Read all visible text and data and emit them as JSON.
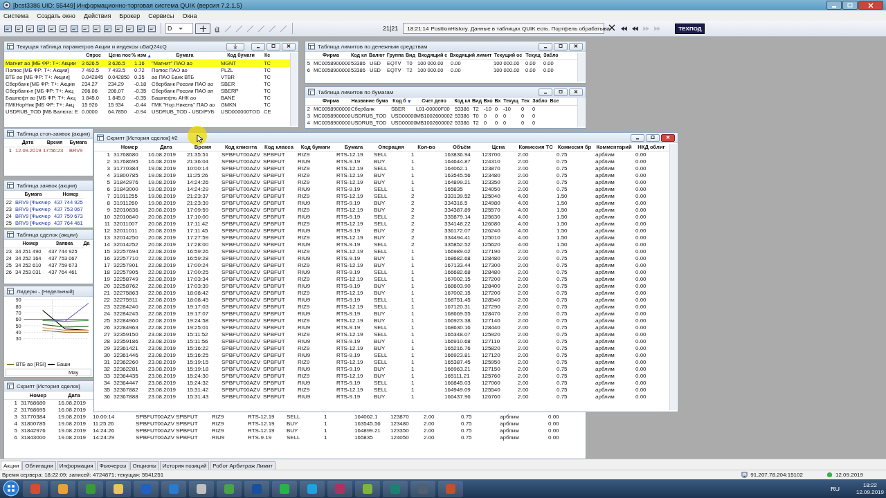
{
  "window": {
    "title": "[bcst3386 UID: 55449] Информационно-торговая система QUIK (версия 7.2.1.5)"
  },
  "menu": [
    "Система",
    "Создать окно",
    "Действия",
    "Брокер",
    "Сервисы",
    "Окна"
  ],
  "toolbar": {
    "interval": "D",
    "counter": "21|21",
    "message_time": "18:21:14",
    "message": "PositionHistory. Данные в таблицах QUIK есть. Портфель обрабатыва",
    "support_label": "ТЕХПОД"
  },
  "windows": [
    {
      "kind": "params",
      "title": "Текущая таблица параметров Акции и индексы u5aQ24cQ",
      "columns": [
        "",
        "Спрос",
        "Цена пос",
        {
          "label": "% изм",
          "sort_icon": "▲"
        },
        "Бумага",
        "Код бумаги",
        "Кс"
      ],
      "rows": [
        {
          "highlighted": true,
          "cells": [
            "Магнит ао [МБ ФР: Т+: Акции",
            "3 626.5",
            "3 626.5",
            "1.16",
            "\"Магнит\" ПАО ао",
            "MGNT",
            "TC"
          ]
        },
        {
          "highlighted": false,
          "cells": [
            "Полюс [МБ ФР: Т+: Акции]",
            "7 492.5",
            "7 493.5",
            "0.72",
            "Полюс ПАО ао",
            "PLZL",
            "TC"
          ]
        },
        {
          "highlighted": false,
          "cells": [
            "ВТБ ао [МБ ФР: Т+: Акции]",
            "0.042845",
            "0.042850",
            "0.35",
            "ао ПАО Банк ВТБ",
            "VTBR",
            "TC"
          ]
        },
        {
          "highlighted": false,
          "cells": [
            "Сбербанк [МБ ФР: Т+: Акции",
            "234.27",
            "234.29",
            "-0.18",
            "Сбербанк России ПАО ао",
            "SBER",
            "TC"
          ]
        },
        {
          "highlighted": false,
          "cells": [
            "Сбербанк-п [МБ ФР: Т+: Акц",
            "206.06",
            "206.07",
            "-0.35",
            "Сбербанк России ПАО ап",
            "SBERP",
            "TC"
          ]
        },
        {
          "highlighted": false,
          "cells": [
            "Башнефт ао [МБ ФР: Т+: Акц",
            "1 845.0",
            "1 845.0",
            "-0.35",
            "Башнефть АНК ао",
            "BANE",
            "TC"
          ]
        },
        {
          "highlighted": false,
          "cells": [
            "ГМКНорНик [МБ ФР: Т+: Акц",
            "15 926",
            "15 934",
            "-0.44",
            "ГМК \"Нор.Никель\" ПАО ао",
            "GMKN",
            "TC"
          ]
        },
        {
          "highlighted": false,
          "cells": [
            "USDRUB_TOD [МБ Валюта: Е",
            "0.0000",
            "64.7850",
            "-0.94",
            "USDRUB_TOD - USD/РУБ",
            "USD000000TOD",
            "CE"
          ]
        }
      ]
    },
    {
      "kind": "money_limits",
      "title": "Таблица лимитов по денежным средствам",
      "columns": [
        "",
        "Фирма",
        "Код кл",
        "Валют",
        "Группа",
        "Вид",
        "Входящий с",
        "Входящий лимит",
        "Текущий ос",
        "Текущ",
        "Забло"
      ],
      "rows": [
        [
          "5",
          "MC0058900000",
          "53386",
          "USD",
          "EQTV",
          "T0",
          "100 000.00",
          "0.00",
          "100 000.00",
          "0.00",
          "0.00"
        ],
        [
          "6",
          "MC0058900000",
          "53386",
          "USD",
          "EQTV",
          "T2",
          "100 000.00",
          "0.00",
          "100 000.00",
          "0.00",
          "0.00"
        ]
      ]
    },
    {
      "kind": "sec_limits",
      "title": "Таблица лимитов по бумагам",
      "columns": [
        "",
        "Фирма",
        "Название бума",
        {
          "label": "Код б",
          "sort_icon": "▼"
        },
        "Счет депо",
        "Код кл",
        "Вид",
        "Вхо",
        "Вх",
        "Текущ",
        "Тек",
        "Забло",
        "Все"
      ],
      "rows": [
        [
          "2",
          "MC0058900000",
          "Сбербанк",
          "SBER",
          "L01-00000F00",
          "53386",
          "T2",
          "-10",
          "0",
          "-10",
          "0",
          "0",
          ""
        ],
        [
          "3",
          "MC0058900000",
          "USDRUB_TOD",
          "USD00000",
          "MB1002600002",
          "53386",
          "T0",
          "0",
          "0",
          "0",
          "0",
          "0",
          ""
        ],
        [
          "4",
          "MC0058900000",
          "USDRUB_TOD",
          "USD00000",
          "MB1002600002",
          "53386",
          "T2",
          "0",
          "0",
          "0",
          "0",
          "0",
          ""
        ]
      ]
    },
    {
      "kind": "stops",
      "title": "Таблица стоп-заявок (акции)",
      "columns": [
        "",
        "Дата",
        "Время",
        "Бумага"
      ],
      "rows": [
        [
          "1",
          "12.09.2019",
          "17:56:23",
          "BRV9"
        ]
      ]
    },
    {
      "kind": "orders",
      "title": "Таблица заявок (акции)",
      "columns": [
        "",
        "Бумага",
        "Номер"
      ],
      "rows": [
        [
          "22",
          "BRV9 [Фьючер",
          "437 744 925"
        ],
        [
          "23",
          "BRV9 [Фьючер",
          "437 753 067"
        ],
        [
          "24",
          "BRV9 [Фьючер",
          "437 759 673"
        ],
        [
          "25",
          "BRV9 [Фьючер",
          "437 764 461"
        ]
      ]
    },
    {
      "kind": "trades",
      "title": "Таблица сделок (акции)",
      "columns": [
        "",
        "Номер",
        "Заявка",
        "Да"
      ],
      "rows": [
        [
          "23",
          "34 251 490",
          "437 744 925"
        ],
        [
          "24",
          "34 252 164",
          "437 753 067"
        ],
        [
          "25",
          "34 252 610",
          "437 759 673"
        ],
        [
          "26",
          "34 253 031",
          "437 764 461"
        ]
      ]
    },
    {
      "kind": "chart",
      "title": "Лидеры - [Недельный]",
      "y_labels": [
        "90",
        "80",
        "70",
        "60",
        "50",
        "40",
        "30"
      ],
      "x_label": "May",
      "legend": [
        {
          "label": "ВТБ ао [RSI]",
          "color": "#8a7a3a"
        },
        {
          "label": "Башн",
          "color": "#000000"
        }
      ]
    },
    {
      "kind": "history_small",
      "title": "Скрипт [История сделок]",
      "columns": [
        "",
        "Номер",
        "Дата"
      ],
      "rows": [
        [
          "1",
          "31768680",
          "16.08.2019"
        ],
        [
          "2",
          "31768695",
          "16.08.2019"
        ],
        [
          "3",
          "31770384",
          "19.08.2019",
          "10:00:14",
          "SPBFUT00AZV",
          "SPBFUT",
          "RIZ9",
          "RTS-12.19",
          "SELL",
          "1",
          "164062.1",
          "123870",
          "2.00",
          "0.75",
          "арблим",
          "0.00"
        ],
        [
          "4",
          "31800785",
          "19.08.2019",
          "11:25:26",
          "SPBFUT00AZV",
          "SPBFUT",
          "RIZ9",
          "RTS-12.19",
          "BUY",
          "1",
          "163545.56",
          "123480",
          "2.00",
          "0.75",
          "арблим",
          "0.00"
        ],
        [
          "5",
          "31842976",
          "19.08.2019",
          "14:24:26",
          "SPBFUT00AZV",
          "SPBFUT",
          "RIZ9",
          "RTS-12.19",
          "BUY",
          "1",
          "164899.21",
          "123350",
          "2.00",
          "0.75",
          "арблим",
          "0.00"
        ],
        [
          "6",
          "31843000",
          "19.08.2019",
          "14:24:29",
          "SPBFUT00AZV",
          "SPBFUT",
          "RIU9",
          "RTS-9.19",
          "SELL",
          "1",
          "165835",
          "124050",
          "2.00",
          "0.75",
          "арблим",
          "0.00"
        ]
      ]
    },
    {
      "kind": "history_main",
      "title": "Скрипт [История сделок] #2",
      "columns": [
        "",
        "Номер",
        "Дата",
        "Время",
        "Код клиента",
        "Код класса",
        "Код бумаги",
        "Бумага",
        "Операция",
        "Кол-во",
        "Объём",
        "Цена",
        "Комиссия ТС",
        "Комиссия бр",
        "Комментарий",
        "НКД облиг"
      ],
      "rows": [
        [
          "1",
          "31768680",
          "16.08.2019",
          "21:35:51",
          "SPBFUT00AZV",
          "SPBFUT",
          "RIZ9",
          "RTS-12.19",
          "SELL",
          "1",
          "163836.94",
          "123700",
          "2.00",
          "0.75",
          "арблим",
          "0.00"
        ],
        [
          "2",
          "31768695",
          "16.08.2019",
          "21:36:04",
          "SPBFUT00AZV",
          "SPBFUT",
          "RIU9",
          "RTS-9.19",
          "BUY",
          "1",
          "164644.87",
          "124310",
          "2.00",
          "0.75",
          "арблим",
          "0.00"
        ],
        [
          "3",
          "31770384",
          "19.08.2019",
          "10:00:14",
          "SPBFUT00AZV",
          "SPBFUT",
          "RIZ9",
          "RTS-12.19",
          "SELL",
          "1",
          "164062.1",
          "123870",
          "2.00",
          "0.75",
          "арблим",
          "0.00"
        ],
        [
          "4",
          "31800785",
          "19.08.2019",
          "11:25:26",
          "SPBFUT00AZV",
          "SPBFUT",
          "RIZ9",
          "RTS-12.19",
          "BUY",
          "1",
          "163545.56",
          "123480",
          "2.00",
          "0.75",
          "арблим",
          "0.00"
        ],
        [
          "5",
          "31842976",
          "19.08.2019",
          "14:24:26",
          "SPBFUT00AZV",
          "SPBFUT",
          "RIZ9",
          "RTS-12.19",
          "BUY",
          "1",
          "164899.21",
          "123350",
          "2.00",
          "0.75",
          "арблим",
          "0.00"
        ],
        [
          "6",
          "31843000",
          "19.08.2019",
          "14:24:29",
          "SPBFUT00AZV",
          "SPBFUT",
          "RIU9",
          "RTS-9.19",
          "SELL",
          "1",
          "165835",
          "124050",
          "2.00",
          "0.75",
          "арблим",
          "0.00"
        ],
        [
          "7",
          "31911255",
          "19.08.2019",
          "21:23:37",
          "SPBFUT00AZV",
          "SPBFUT",
          "RIZ9",
          "RTS-12.19",
          "SELL",
          "2",
          "333139.52",
          "125040",
          "4.00",
          "1.50",
          "арблим",
          "0.00"
        ],
        [
          "8",
          "31911260",
          "19.08.2019",
          "21:23:39",
          "SPBFUT00AZV",
          "SPBFUT",
          "RIU9",
          "RTS-9.19",
          "BUY",
          "2",
          "334316.5",
          "124980",
          "4.00",
          "1.50",
          "арблим",
          "0.00"
        ],
        [
          "9",
          "32010636",
          "20.08.2019",
          "17:09:59",
          "SPBFUT00AZV",
          "SPBFUT",
          "RIZ9",
          "RTS-12.19",
          "BUY",
          "2",
          "334387.89",
          "125570",
          "4.00",
          "1.50",
          "арблим",
          "0.00"
        ],
        [
          "10",
          "32010640",
          "20.08.2019",
          "17:10:00",
          "SPBFUT00AZV",
          "SPBFUT",
          "RIU9",
          "RTS-9.19",
          "SELL",
          "2",
          "335879.14",
          "125630",
          "4.00",
          "1.50",
          "арблим",
          "0.00"
        ],
        [
          "11",
          "32011007",
          "20.08.2019",
          "17:11:42",
          "SPBFUT00AZV",
          "SPBFUT",
          "RIZ9",
          "RTS-12.19",
          "SELL",
          "2",
          "334148.22",
          "126080",
          "4.00",
          "1.50",
          "арблим",
          "0.00"
        ],
        [
          "12",
          "32011011",
          "20.08.2019",
          "17:11:45",
          "SPBFUT00AZV",
          "SPBFUT",
          "RIU9",
          "RTS-9.19",
          "BUY",
          "2",
          "336172.07",
          "126240",
          "4.00",
          "1.50",
          "арблим",
          "0.00"
        ],
        [
          "13",
          "32014250",
          "20.08.2019",
          "17:27:59",
          "SPBFUT00AZV",
          "SPBFUT",
          "RIZ9",
          "RTS-12.19",
          "BUY",
          "2",
          "334494.41",
          "125010",
          "4.00",
          "1.50",
          "арблим",
          "0.00"
        ],
        [
          "14",
          "32014252",
          "20.08.2019",
          "17:28:00",
          "SPBFUT00AZV",
          "SPBFUT",
          "RIU9",
          "RTS-9.19",
          "SELL",
          "2",
          "335852.52",
          "125620",
          "4.00",
          "1.50",
          "арблим",
          "0.00"
        ],
        [
          "15",
          "32257694",
          "22.08.2019",
          "16:59:26",
          "SPBFUT00AZV",
          "SPBFUT",
          "RIZ9",
          "RTS-12.19",
          "SELL",
          "1",
          "166989.02",
          "127190",
          "2.00",
          "0.75",
          "арблим",
          "0.00"
        ],
        [
          "16",
          "32257710",
          "22.08.2019",
          "16:59:28",
          "SPBFUT00AZV",
          "SPBFUT",
          "RIU9",
          "RTS-9.19",
          "BUY",
          "1",
          "168682.68",
          "128480",
          "2.00",
          "0.75",
          "арблим",
          "0.00"
        ],
        [
          "17",
          "32257901",
          "22.08.2019",
          "17:00:24",
          "SPBFUT00AZV",
          "SPBFUT",
          "RIZ9",
          "RTS-12.19",
          "BUY",
          "1",
          "167133.44",
          "127300",
          "2.00",
          "0.75",
          "арблим",
          "0.00"
        ],
        [
          "18",
          "32257905",
          "22.08.2019",
          "17:00:25",
          "SPBFUT00AZV",
          "SPBFUT",
          "RIU9",
          "RTS-9.19",
          "SELL",
          "1",
          "166682.68",
          "128480",
          "2.00",
          "0.75",
          "арблим",
          "0.00"
        ],
        [
          "19",
          "32258749",
          "22.08.2019",
          "17:03:34",
          "SPBFUT00AZV",
          "SPBFUT",
          "RIZ9",
          "RTS-12.19",
          "SELL",
          "1",
          "167002.15",
          "127200",
          "2.00",
          "0.75",
          "арблим",
          "0.00"
        ],
        [
          "20",
          "32258762",
          "22.08.2019",
          "17:03:39",
          "SPBFUT00AZV",
          "SPBFUT",
          "RIU9",
          "RTS-9.19",
          "BUY",
          "1",
          "168603.90",
          "128400",
          "2.00",
          "0.75",
          "арблим",
          "0.00"
        ],
        [
          "21",
          "32275863",
          "22.08.2019",
          "18:08:42",
          "SPBFUT00AZV",
          "SPBFUT",
          "RIZ9",
          "RTS-12.19",
          "BUY",
          "1",
          "167002.15",
          "127200",
          "2.00",
          "0.75",
          "арблим",
          "0.00"
        ],
        [
          "22",
          "32275911",
          "22.08.2019",
          "18:08:45",
          "SPBFUT00AZV",
          "SPBFUT",
          "RIU9",
          "RTS-9.19",
          "SELL",
          "1",
          "168751.45",
          "128540",
          "2.00",
          "0.75",
          "арблим",
          "0.00"
        ],
        [
          "23",
          "32284240",
          "22.08.2019",
          "19:17:03",
          "SPBFUT00AZV",
          "SPBFUT",
          "RIZ9",
          "RTS-12.19",
          "SELL",
          "1",
          "167120.31",
          "127290",
          "2.00",
          "0.75",
          "арблим",
          "0.00"
        ],
        [
          "24",
          "32284245",
          "22.08.2019",
          "19:17:07",
          "SPBFUT00AZV",
          "SPBFUT",
          "RIU9",
          "RTS-9.19",
          "BUY",
          "1",
          "168669.55",
          "128470",
          "2.00",
          "0.75",
          "арблим",
          "0.00"
        ],
        [
          "25",
          "32284960",
          "22.08.2019",
          "19:24:58",
          "SPBFUT00AZV",
          "SPBFUT",
          "RIZ9",
          "RTS-12.19",
          "BUY",
          "1",
          "166923.38",
          "127140",
          "2.00",
          "0.75",
          "арблим",
          "0.00"
        ],
        [
          "26",
          "32284963",
          "22.08.2019",
          "19:25:01",
          "SPBFUT00AZV",
          "SPBFUT",
          "RIU9",
          "RTS-9.19",
          "SELL",
          "1",
          "168630.16",
          "128440",
          "2.00",
          "0.75",
          "арблим",
          "0.00"
        ],
        [
          "27",
          "32359150",
          "23.08.2019",
          "15:11:52",
          "SPBFUT00AZV",
          "SPBFUT",
          "RIZ9",
          "RTS-12.19",
          "SELL",
          "1",
          "165348.07",
          "125920",
          "2.00",
          "0.75",
          "арблим",
          "0.00"
        ],
        [
          "28",
          "32359186",
          "23.08.2019",
          "15:11:56",
          "SPBFUT00AZV",
          "SPBFUT",
          "RIU9",
          "RTS-9.19",
          "BUY",
          "1",
          "166910.68",
          "127110",
          "2.00",
          "0.75",
          "арблим",
          "0.00"
        ],
        [
          "29",
          "32361421",
          "23.08.2019",
          "15:16:22",
          "SPBFUT00AZV",
          "SPBFUT",
          "RIZ9",
          "RTS-12.19",
          "BUY",
          "1",
          "165216.76",
          "125820",
          "2.00",
          "0.75",
          "арблим",
          "0.00"
        ],
        [
          "30",
          "32361446",
          "23.08.2019",
          "15:16:25",
          "SPBFUT00AZV",
          "SPBFUT",
          "RIU9",
          "RTS-9.19",
          "SELL",
          "1",
          "166923.81",
          "127120",
          "2.00",
          "0.75",
          "арблим",
          "0.00"
        ],
        [
          "31",
          "32362260",
          "23.08.2019",
          "15:19:15",
          "SPBFUT00AZV",
          "SPBFUT",
          "RIZ9",
          "RTS-12.19",
          "SELL",
          "1",
          "165387.45",
          "125950",
          "2.00",
          "0.75",
          "арблим",
          "0.00"
        ],
        [
          "32",
          "32362281",
          "23.08.2019",
          "15:19:18",
          "SPBFUT00AZV",
          "SPBFUT",
          "RIU9",
          "RTS-9.19",
          "BUY",
          "1",
          "166963.21",
          "127150",
          "2.00",
          "0.75",
          "арблим",
          "0.00"
        ],
        [
          "33",
          "32364435",
          "23.08.2019",
          "15:24:30",
          "SPBFUT00AZV",
          "SPBFUT",
          "RIZ9",
          "RTS-12.19",
          "BUY",
          "1",
          "165111.21",
          "125760",
          "2.00",
          "0.75",
          "арблим",
          "0.00"
        ],
        [
          "34",
          "32364447",
          "23.08.2019",
          "15:24:32",
          "SPBFUT00AZV",
          "SPBFUT",
          "RIU9",
          "RTS-9.19",
          "SELL",
          "1",
          "166845.03",
          "127060",
          "2.00",
          "0.75",
          "арблим",
          "0.00"
        ],
        [
          "35",
          "32367882",
          "23.08.2019",
          "15:31:42",
          "SPBFUT00AZV",
          "SPBFUT",
          "RIZ9",
          "RTS-12.19",
          "SELL",
          "1",
          "164949.09",
          "125540",
          "2.00",
          "0.75",
          "арблим",
          "0.00"
        ],
        [
          "36",
          "32367888",
          "23.08.2019",
          "15:31:43",
          "SPBFUT00AZV",
          "SPBFUT",
          "RIU9",
          "RTS-9.19",
          "BUY",
          "1",
          "166437.96",
          "126760",
          "2.00",
          "0.75",
          "арблим",
          "0.00"
        ]
      ]
    }
  ],
  "tabs": [
    {
      "label": "Акции",
      "selected": true
    },
    {
      "label": "Облигации",
      "selected": false
    },
    {
      "label": "Информация",
      "selected": false
    },
    {
      "label": "Фьючерсы",
      "selected": false
    },
    {
      "label": "Опционы",
      "selected": false
    },
    {
      "label": "История позиций",
      "selected": false
    },
    {
      "label": "Робот Арбитраж Лимит",
      "selected": false
    }
  ],
  "status_bar": {
    "text": "Время сервера: 18:22:09; записей: 4724871; текущая: 5541251",
    "server": "91.207.78.204:15102",
    "date": "12.09.2019"
  },
  "taskbar": {
    "language": "RU",
    "time": "18:22",
    "date": "12.09.2019"
  }
}
